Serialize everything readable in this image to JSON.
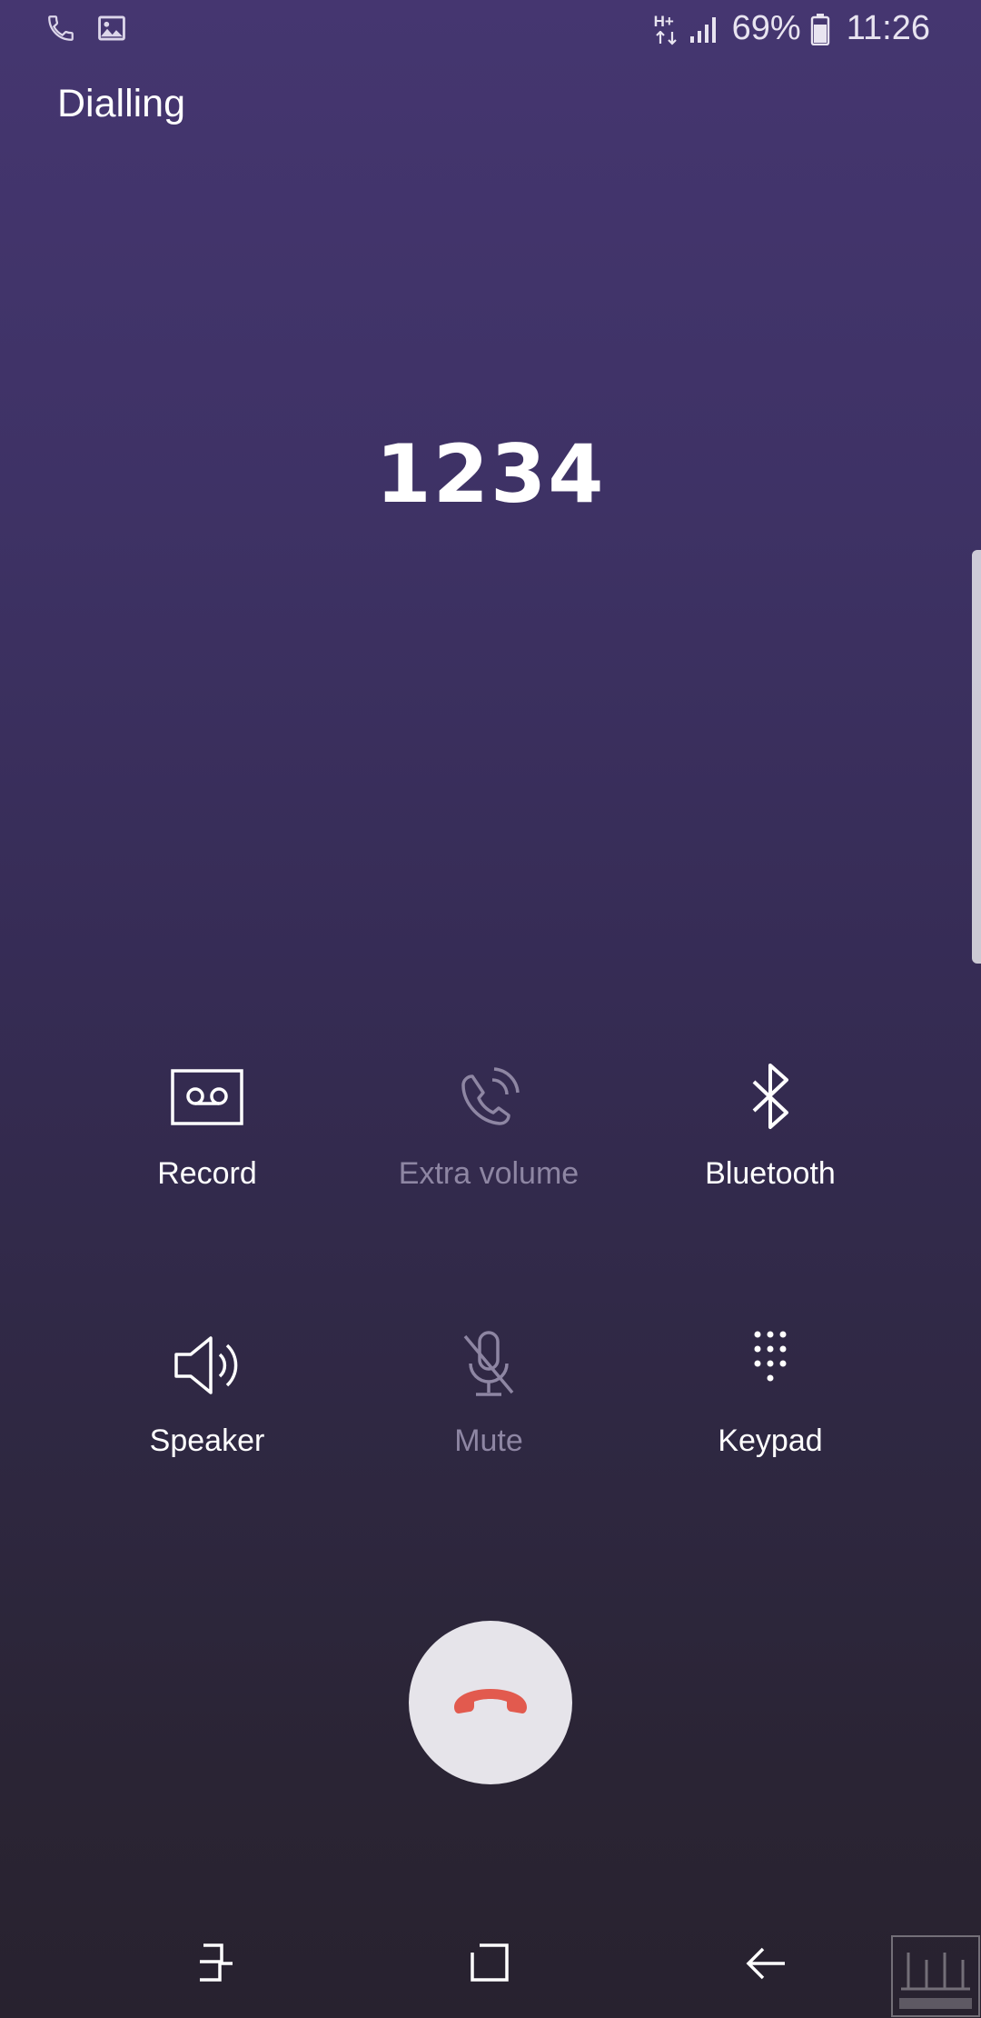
{
  "status_bar": {
    "icons_left": [
      "phone-icon",
      "image-icon"
    ],
    "network": "H+",
    "signal_icon": "signal-icon",
    "battery_percent": "69%",
    "battery_icon": "battery-icon",
    "time": "11:26"
  },
  "call": {
    "state": "Dialling",
    "number": "1234"
  },
  "actions": [
    {
      "label": "Record",
      "icon": "voicemail-tape-icon",
      "enabled": true
    },
    {
      "label": "Extra volume",
      "icon": "phone-volume-icon",
      "enabled": false
    },
    {
      "label": "Bluetooth",
      "icon": "bluetooth-icon",
      "enabled": true
    },
    {
      "label": "Speaker",
      "icon": "speaker-icon",
      "enabled": true
    },
    {
      "label": "Mute",
      "icon": "microphone-off-icon",
      "enabled": false
    },
    {
      "label": "Keypad",
      "icon": "keypad-icon",
      "enabled": true
    }
  ],
  "end_call": {
    "icon": "end-call-icon",
    "color": "#e25a4e"
  },
  "nav": {
    "icons": [
      "recent-apps-icon",
      "home-icon",
      "back-icon"
    ]
  },
  "colors": {
    "background_top": "#453670",
    "background_bottom": "#28222f",
    "disabled_text": "#8e86a3",
    "end_call_bg": "#e6e4ea"
  }
}
